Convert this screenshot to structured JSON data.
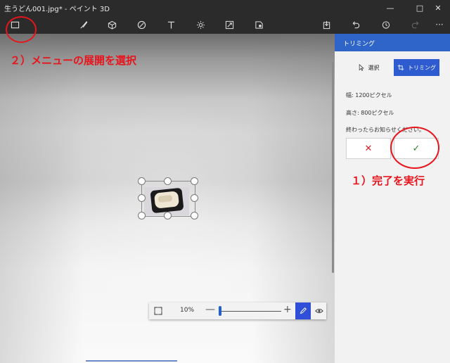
{
  "window": {
    "title": "生うどん001.jpg* - ペイント 3D",
    "minimize": "—",
    "maximize": "□",
    "close": "✕"
  },
  "toolbar": {
    "icons": [
      "menu-icon",
      "brush-icon",
      "3d-shapes-icon",
      "stickers-icon",
      "text-icon",
      "effects-icon",
      "canvas-icon",
      "3d-library-icon",
      "paste-icon",
      "undo-icon",
      "history-icon",
      "redo-icon",
      "more-icon"
    ],
    "more": "···"
  },
  "annotations": {
    "menu_step": "２）メニューの展開を選択",
    "done_step": "１）完了を実行"
  },
  "panel": {
    "title": "トリミング",
    "tab_select": "選択",
    "tab_crop": "トリミング",
    "width_label": "幅: 1200ピクセル",
    "height_label": "高さ: 800ピクセル",
    "notice": "終わったらお知らせください。",
    "cancel": "✕",
    "confirm": "✓"
  },
  "zoom": {
    "value": "10%",
    "minus": "—",
    "plus": "+",
    "level_fraction": 0.0
  },
  "colors": {
    "accent": "#2f64c8",
    "annotation": "#e8141c"
  }
}
